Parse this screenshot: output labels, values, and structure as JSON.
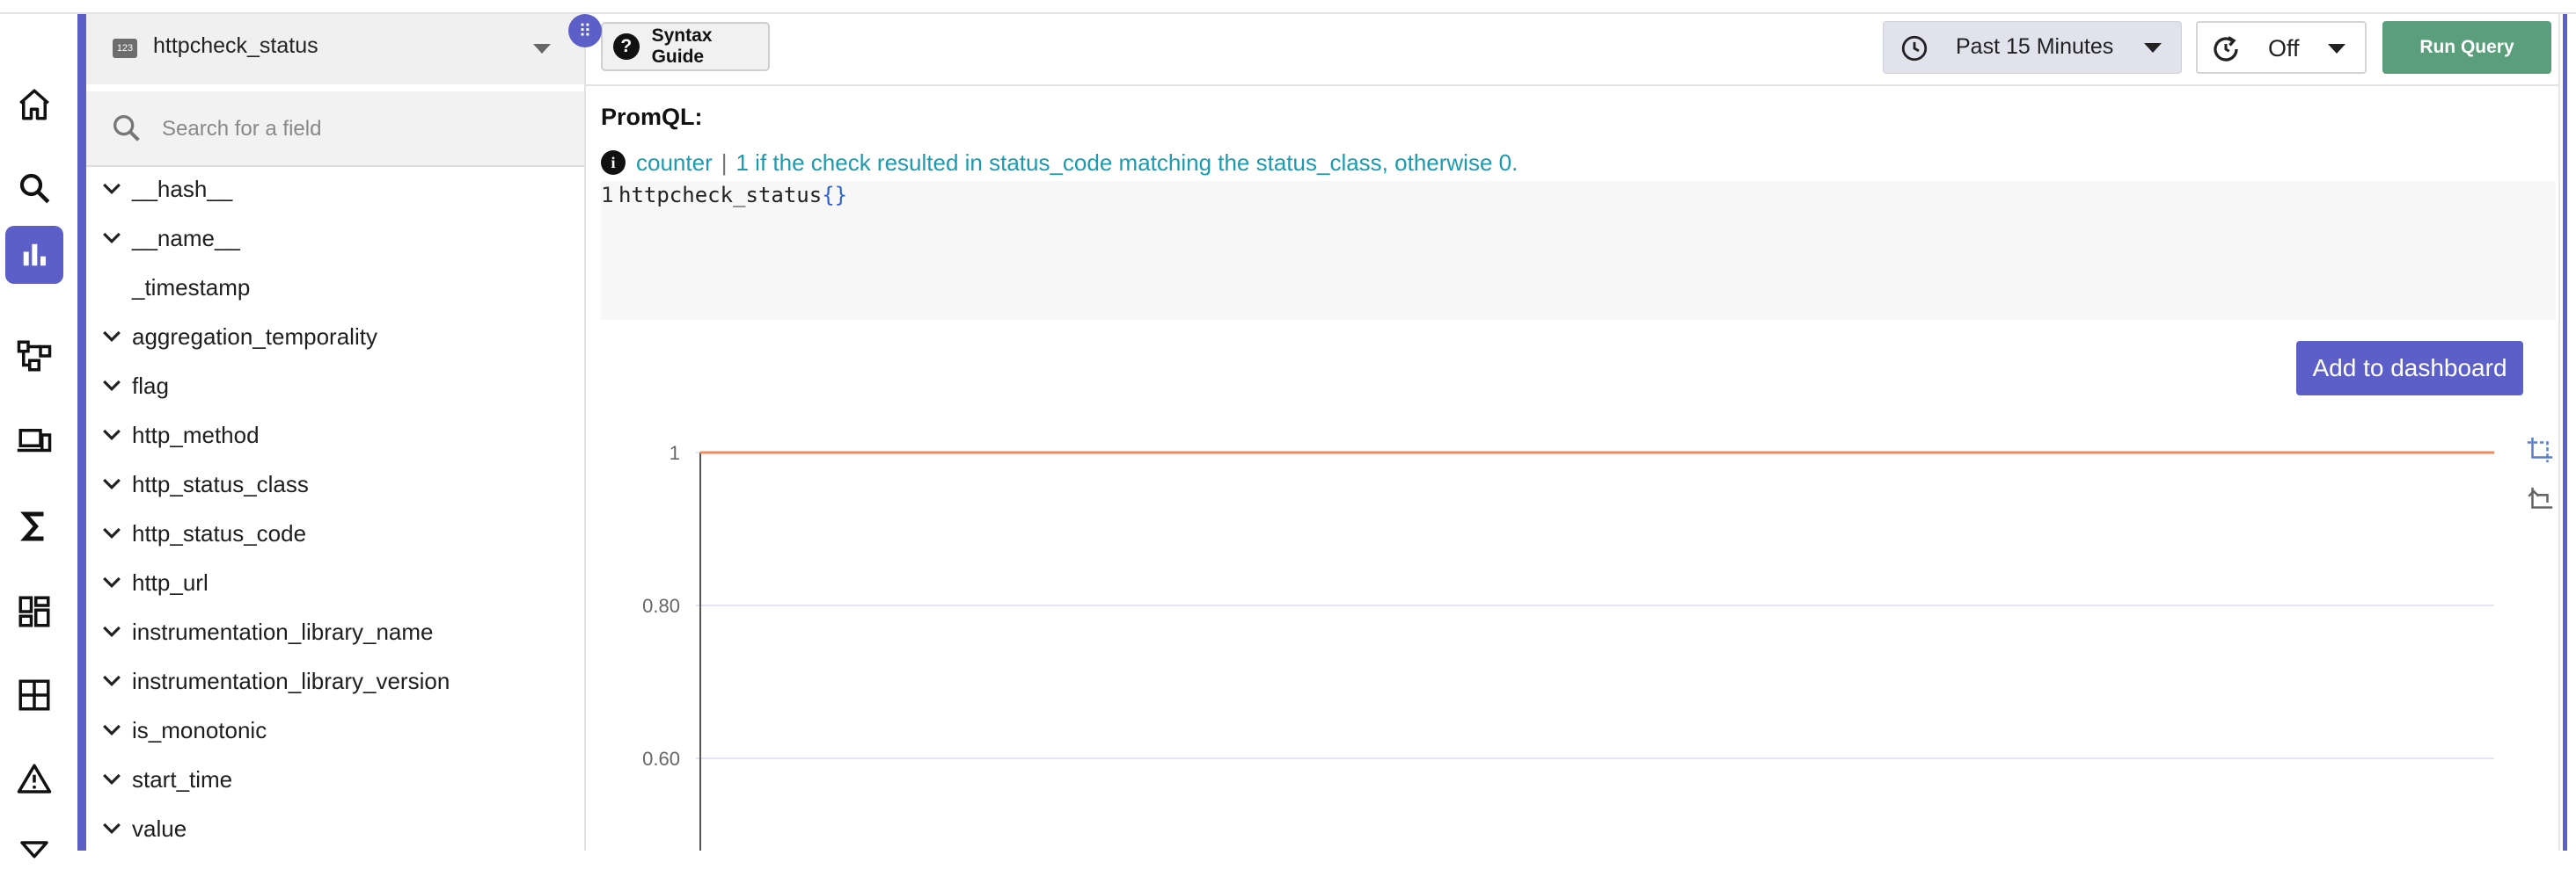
{
  "nav": {
    "items": [
      {
        "name": "home-icon"
      },
      {
        "name": "search-icon"
      },
      {
        "name": "metrics-icon",
        "active": true
      },
      {
        "name": "traces-icon"
      },
      {
        "name": "rum-icon"
      },
      {
        "name": "functions-icon"
      },
      {
        "name": "dashboards-icon"
      },
      {
        "name": "streams-icon"
      },
      {
        "name": "alerts-icon"
      },
      {
        "name": "pipelines-icon"
      }
    ],
    "accent_color": "#5b5fc7"
  },
  "fields_panel": {
    "metric_badge": "123",
    "selected_metric": "httpcheck_status",
    "search_placeholder": "Search for a field",
    "fields": [
      {
        "label": "__hash__",
        "expandable": true
      },
      {
        "label": "__name__",
        "expandable": true
      },
      {
        "label": "_timestamp",
        "expandable": false
      },
      {
        "label": "aggregation_temporality",
        "expandable": true
      },
      {
        "label": "flag",
        "expandable": true
      },
      {
        "label": "http_method",
        "expandable": true
      },
      {
        "label": "http_status_class",
        "expandable": true
      },
      {
        "label": "http_status_code",
        "expandable": true
      },
      {
        "label": "http_url",
        "expandable": true
      },
      {
        "label": "instrumentation_library_name",
        "expandable": true
      },
      {
        "label": "instrumentation_library_version",
        "expandable": true
      },
      {
        "label": "is_monotonic",
        "expandable": true
      },
      {
        "label": "start_time",
        "expandable": true
      },
      {
        "label": "value",
        "expandable": true
      }
    ]
  },
  "toolbar": {
    "syntax_guide_label": "Syntax Guide",
    "time_range_label": "Past 15 Minutes",
    "refresh_label": "Off",
    "run_query_label": "Run Query",
    "run_query_color": "#5a9e7b"
  },
  "query": {
    "title": "PromQL:",
    "metric_type": "counter",
    "separator": "|",
    "description": "1 if the check resulted in status_code matching the status_class, otherwise 0.",
    "line_number": "1",
    "code_metric": "httpcheck_status",
    "code_braces": "{}"
  },
  "actions": {
    "add_to_dashboard_label": "Add to dashboard"
  },
  "chart_data": {
    "type": "line",
    "title": "",
    "xlabel": "",
    "ylabel": "",
    "y_ticks": [
      "1",
      "0.80",
      "0.60"
    ],
    "ylim_visible": [
      0.5,
      1
    ],
    "grid": true,
    "series": [
      {
        "color": "#f28c5e",
        "values": [
          1,
          1
        ]
      }
    ]
  }
}
